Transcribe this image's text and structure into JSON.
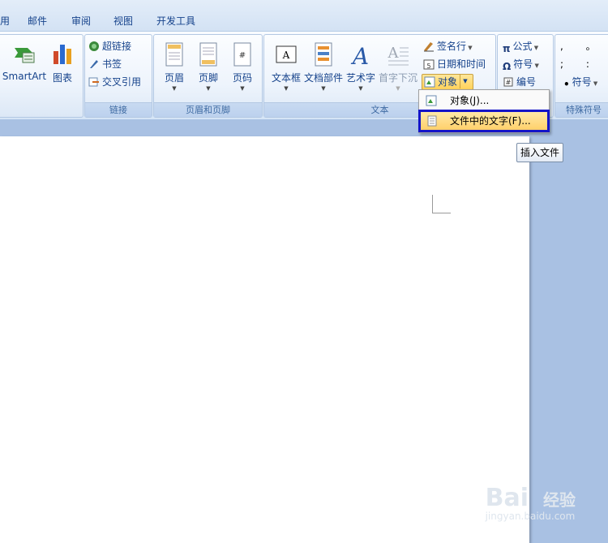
{
  "tabs": [
    "用",
    "邮件",
    "审阅",
    "视图",
    "开发工具"
  ],
  "groups": {
    "illustrations": {
      "smartart": "SmartArt",
      "chart": "图表"
    },
    "links": {
      "label": "链接",
      "hyperlink": "超链接",
      "bookmark": "书签",
      "crossref": "交叉引用"
    },
    "header_footer": {
      "label": "页眉和页脚",
      "header": "页眉",
      "footer": "页脚",
      "page_number": "页码"
    },
    "text": {
      "label": "文本",
      "textbox": "文本框",
      "quickparts": "文档部件",
      "wordart": "艺术字",
      "dropcap": "首字下沉",
      "signature_line": "签名行",
      "date_time": "日期和时间",
      "object": "对象"
    },
    "symbols": {
      "equation": "公式",
      "symbol": "符号",
      "numbering": "编号"
    },
    "special": {
      "label": "特殊符号",
      "symbol": "符号"
    }
  },
  "menu": {
    "item1": "对象(J)...",
    "item2": "文件中的文字(F)..."
  },
  "tooltip": "插入文件",
  "watermark": {
    "brand": "Bai",
    "brand2": "经验",
    "url": "jingyan.baidu.com"
  }
}
